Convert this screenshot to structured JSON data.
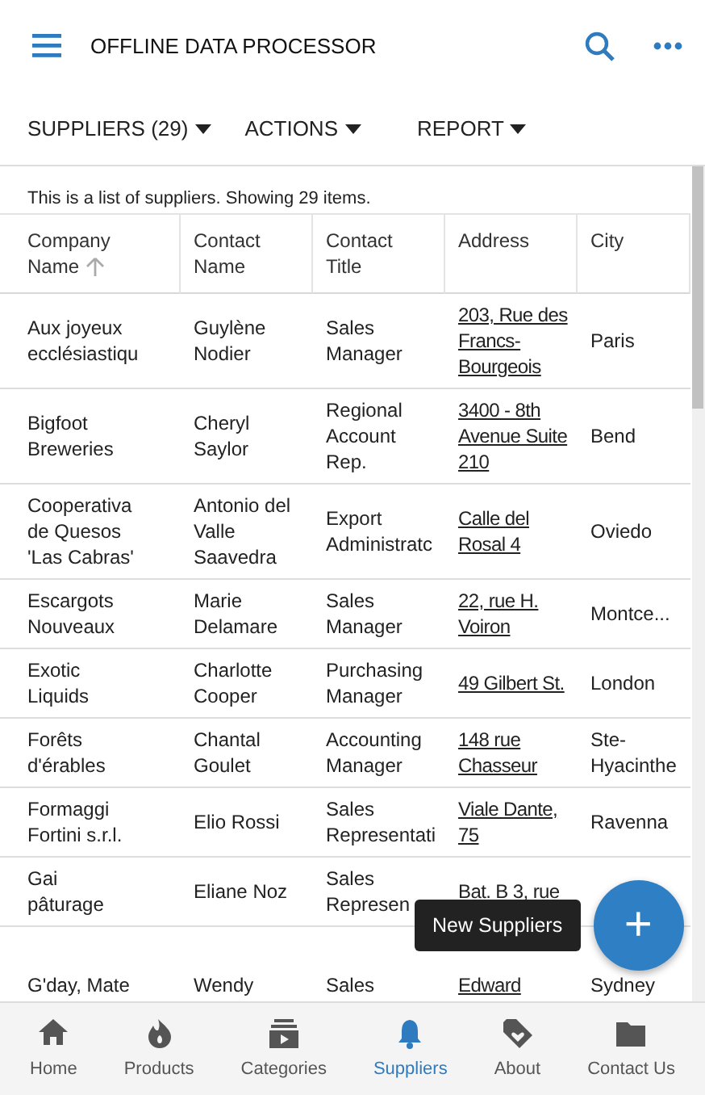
{
  "app_bar": {
    "title": "OFFLINE DATA PROCESSOR"
  },
  "toolbar": [
    {
      "label": "SUPPLIERS (29)"
    },
    {
      "label": "ACTIONS"
    },
    {
      "label": "REPORT"
    }
  ],
  "table": {
    "caption": "This is a list of suppliers. Showing 29 items.",
    "columns": [
      {
        "label": "Company Name",
        "sorted": true,
        "kind": "text"
      },
      {
        "label": "Contact Name",
        "sorted": false,
        "kind": "text"
      },
      {
        "label": "Contact Title",
        "sorted": false,
        "kind": "text"
      },
      {
        "label": "Address",
        "sorted": false,
        "kind": "link"
      },
      {
        "label": "City",
        "sorted": false,
        "kind": "text"
      }
    ],
    "rows": [
      [
        "Aux joyeux ecclésiastiqu",
        "Guylène Nodier",
        "Sales Manager",
        "203, Rue des Francs-Bourgeois",
        "Paris"
      ],
      [
        "Bigfoot Breweries",
        "Cheryl Saylor",
        "Regional Account Rep.",
        "3400 - 8th Avenue Suite 210",
        "Bend"
      ],
      [
        "Cooperativa de Quesos 'Las Cabras'",
        "Antonio del Valle Saavedra",
        "Export Administratc",
        "Calle del Rosal 4",
        "Oviedo"
      ],
      [
        "Escargots Nouveaux",
        "Marie Delamare",
        "Sales Manager",
        "22, rue H. Voiron",
        "Montce..."
      ],
      [
        "Exotic Liquids",
        "Charlotte Cooper",
        "Purchasing Manager",
        "49 Gilbert St.",
        "London"
      ],
      [
        "Forêts d'érables",
        "Chantal Goulet",
        "Accounting Manager",
        "148 rue Chasseur",
        "Ste-Hyacinthe"
      ],
      [
        "Formaggi Fortini s.r.l.",
        "Elio Rossi",
        "Sales Representati",
        "Viale Dante, 75",
        "Ravenna"
      ],
      [
        "Gai pâturage",
        "Eliane Noz",
        "Sales Represen",
        "Bat. B 3, rue",
        ""
      ],
      [
        "G'day, Mate",
        "Wendy",
        "Sales",
        "Edward",
        "Sydney"
      ]
    ]
  },
  "tooltip": "New Suppliers",
  "fab": {
    "label": "+"
  },
  "bottom_nav": [
    {
      "label": "Home",
      "kind": "home",
      "selected": false
    },
    {
      "label": "Products",
      "kind": "flame",
      "selected": false
    },
    {
      "label": "Categories",
      "kind": "categories",
      "selected": false
    },
    {
      "label": "Suppliers",
      "kind": "bell",
      "selected": true
    },
    {
      "label": "About",
      "kind": "tag",
      "selected": false
    },
    {
      "label": "Contact Us",
      "kind": "folder",
      "selected": false
    }
  ]
}
